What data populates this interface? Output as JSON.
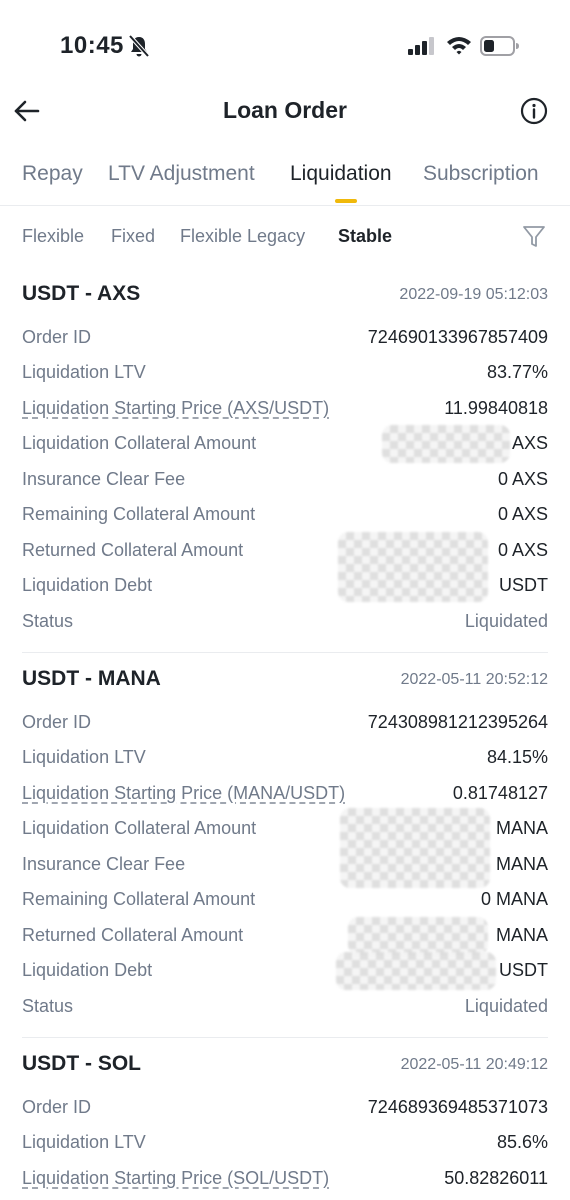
{
  "status_bar": {
    "time": "10:45"
  },
  "header": {
    "title": "Loan Order"
  },
  "main_tabs": [
    "Repay",
    "LTV Adjustment",
    "Liquidation",
    "Subscription"
  ],
  "sub_tabs": [
    "Flexible",
    "Fixed",
    "Flexible Legacy",
    "Stable"
  ],
  "labels": {
    "order_id": "Order ID",
    "liq_ltv": "Liquidation LTV",
    "collateral_amount": "Liquidation Collateral Amount",
    "insurance_fee": "Insurance Clear Fee",
    "remaining_collateral": "Remaining Collateral Amount",
    "returned_collateral": "Returned Collateral Amount",
    "liq_debt": "Liquidation Debt",
    "status": "Status"
  },
  "orders": [
    {
      "pair": "USDT - AXS",
      "time": "2022-09-19 05:12:03",
      "price_label": "Liquidation Starting Price (AXS/USDT)",
      "order_id": "724690133967857409",
      "liq_ltv": "83.77%",
      "start_price": "11.99840818",
      "collateral_amount": "AXS",
      "insurance_fee": "0 AXS",
      "remaining_collateral": "0 AXS",
      "returned_collateral": "0 AXS",
      "liq_debt": "USDT",
      "status": "Liquidated"
    },
    {
      "pair": "USDT - MANA",
      "time": "2022-05-11 20:52:12",
      "price_label": "Liquidation Starting Price (MANA/USDT)",
      "order_id": "724308981212395264",
      "liq_ltv": "84.15%",
      "start_price": "0.81748127",
      "collateral_amount": "MANA",
      "insurance_fee": "MANA",
      "remaining_collateral": "0 MANA",
      "returned_collateral": "MANA",
      "liq_debt": "USDT",
      "status": "Liquidated"
    },
    {
      "pair": "USDT - SOL",
      "time": "2022-05-11 20:49:12",
      "price_label": "Liquidation Starting Price (SOL/USDT)",
      "order_id": "724689369485371073",
      "liq_ltv": "85.6%",
      "start_price": "50.82826011"
    }
  ]
}
